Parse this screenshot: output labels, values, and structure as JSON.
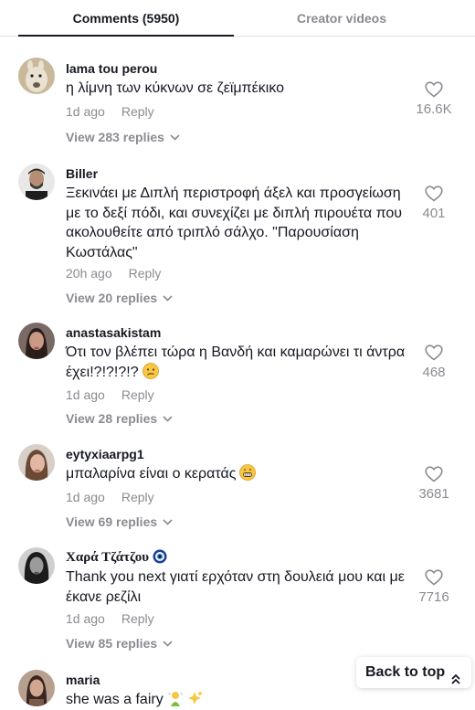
{
  "tabs": {
    "comments_label": "Comments (5950)",
    "creator_label": "Creator videos"
  },
  "comments": [
    {
      "username": "lama tou perou",
      "text": "η λίμνη των κύκνων σε ζεϊμπέκικο",
      "time": "1d ago",
      "reply": "Reply",
      "view_replies": "View 283 replies",
      "likes": "16.6K",
      "avatar": "llama-avatar"
    },
    {
      "username": "Biller",
      "text": "Ξεκινάει με Διπλή περιστροφή άξελ και προσγείωση με το δεξί πόδι, και συνεχίζει με διπλή πιρουέτα που ακολουθείτε από τριπλό σάλχο. \"Παρουσίαση Κωστάλας\"",
      "time": "20h ago",
      "reply": "Reply",
      "view_replies": "View 20 replies",
      "likes": "401",
      "avatar": "man-avatar"
    },
    {
      "username": "anastasakistam",
      "text": "Ότι τον βλέπει τώρα η Βανδή και καμαρώνει τι άντρα έχει!?!?!?!?",
      "time": "1d ago",
      "reply": "Reply",
      "view_replies": "View 28 replies",
      "likes": "468",
      "avatar": "woman-avatar",
      "emoji": "confused-face-emoji"
    },
    {
      "username": "eytyxiaarpg1",
      "text": "μπαλαρίνα είναι ο κερατάς",
      "time": "1d ago",
      "reply": "Reply",
      "view_replies": "View 69 replies",
      "likes": "3681",
      "avatar": "woman-avatar-2",
      "emoji": "grinning-face-emoji"
    },
    {
      "username": "Χαρά Τζάτζου",
      "text": "Thank you next γιατί ερχόταν στη δουλειά μου και με έκανε ρεζίλι",
      "time": "1d ago",
      "reply": "Reply",
      "view_replies": "View 85 replies",
      "likes": "7716",
      "avatar": "woman-avatar-bw",
      "badge": "nazar-eye-emoji"
    },
    {
      "username": "maria",
      "text": "she was a fairy",
      "time": "",
      "reply": "",
      "view_replies": "",
      "likes": "",
      "avatar": "woman-avatar-3",
      "emoji": "fairy-sparkles-emoji"
    }
  ],
  "back_to_top": "Back to top",
  "colors": {
    "text": "#161823",
    "muted": "#8a8b91",
    "divider": "#e3e3e4"
  }
}
